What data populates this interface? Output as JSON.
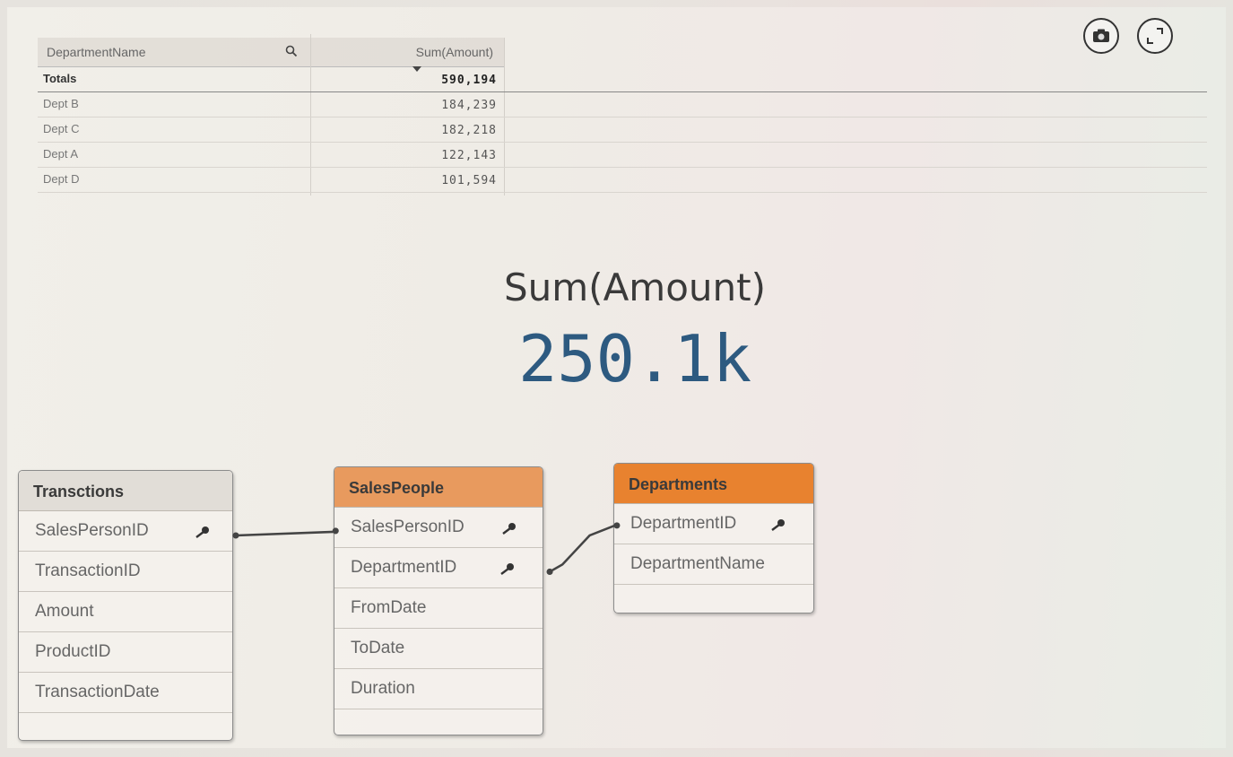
{
  "toolbar": {
    "snapshot_icon": "camera-icon",
    "expand_icon": "expand-icon"
  },
  "table": {
    "header": {
      "dimension": "DepartmentName",
      "measure": "Sum(Amount)"
    },
    "totals": {
      "label": "Totals",
      "value": "590,194"
    },
    "rows": [
      {
        "name": "Dept B",
        "value": "184,239"
      },
      {
        "name": "Dept C",
        "value": "182,218"
      },
      {
        "name": "Dept A",
        "value": "122,143"
      },
      {
        "name": "Dept D",
        "value": "101,594"
      }
    ]
  },
  "kpi": {
    "title": "Sum(Amount)",
    "value": "250.1k"
  },
  "data_model": {
    "transactions": {
      "name": "Transctions",
      "fields": [
        "SalesPersonID",
        "TransactionID",
        "Amount",
        "ProductID",
        "TransactionDate"
      ]
    },
    "salespeople": {
      "name": "SalesPeople",
      "fields": [
        "SalesPersonID",
        "DepartmentID",
        "FromDate",
        "ToDate",
        "Duration"
      ]
    },
    "departments": {
      "name": "Departments",
      "fields": [
        "DepartmentID",
        "DepartmentName"
      ]
    }
  },
  "colors": {
    "kpi_value": "#2d5a80",
    "salespeople_header": "#e89a5e",
    "departments_header": "#e8822f"
  }
}
